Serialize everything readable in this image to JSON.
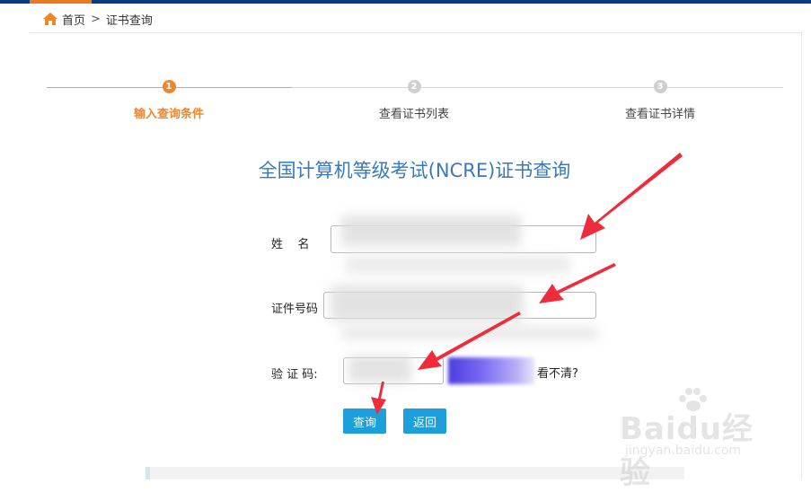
{
  "breadcrumb": {
    "home": "首页",
    "separator": ">",
    "current": "证书查询"
  },
  "steps": [
    {
      "number": "1",
      "label": "输入查询条件",
      "active": true
    },
    {
      "number": "2",
      "label": "查看证书列表",
      "active": false
    },
    {
      "number": "3",
      "label": "查看证书详情",
      "active": false
    }
  ],
  "page_title": "全国计算机等级考试(NCRE)证书查询",
  "form": {
    "name_label": "姓    名",
    "name_value": "",
    "id_label": "证件号码",
    "id_value": "",
    "captcha_label": "验 证 码:",
    "captcha_value": "",
    "captcha_refresh": "看不清?"
  },
  "buttons": {
    "query": "查询",
    "back": "返回"
  },
  "watermark": {
    "text": "Baidu经验",
    "sub": "jingyan.baidu.com"
  },
  "colors": {
    "accent": "#f0862a",
    "brand": "#0d3c87",
    "button": "#1c9fdb",
    "title": "#3a79b9",
    "annotation": "#ee2c3c"
  }
}
